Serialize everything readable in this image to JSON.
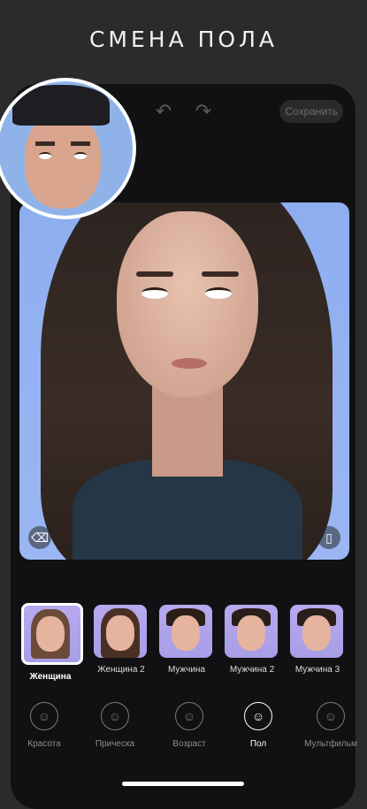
{
  "headline": "СМЕНА ПОЛА",
  "toolbar": {
    "undo_icon": "undo-arrow-icon",
    "redo_icon": "redo-arrow-icon",
    "save_label": "Сохранить"
  },
  "photo": {
    "eraser_icon": "eraser-icon",
    "compare_icon": "compare-icon"
  },
  "styles": [
    {
      "label": "Женщина",
      "selected": true
    },
    {
      "label": "Женщина 2",
      "selected": false
    },
    {
      "label": "Мужчина",
      "selected": false
    },
    {
      "label": "Мужчина 2",
      "selected": false
    },
    {
      "label": "Мужчина 3",
      "selected": false
    }
  ],
  "tabs": [
    {
      "label": "Красота",
      "icon": "face-sparkle-icon",
      "active": false
    },
    {
      "label": "Прическа",
      "icon": "hairstyle-icon",
      "active": false
    },
    {
      "label": "Возраст",
      "icon": "age-face-icon",
      "active": false
    },
    {
      "label": "Пол",
      "icon": "gender-face-icon",
      "active": true
    },
    {
      "label": "Мультфильм",
      "icon": "cartoon-face-icon",
      "active": false
    }
  ],
  "colors": {
    "background": "#2b2b2d",
    "phone_background": "#111113",
    "photo_sky": "#9ab7f3",
    "thumbnail_bg": "#b7a9f0"
  }
}
